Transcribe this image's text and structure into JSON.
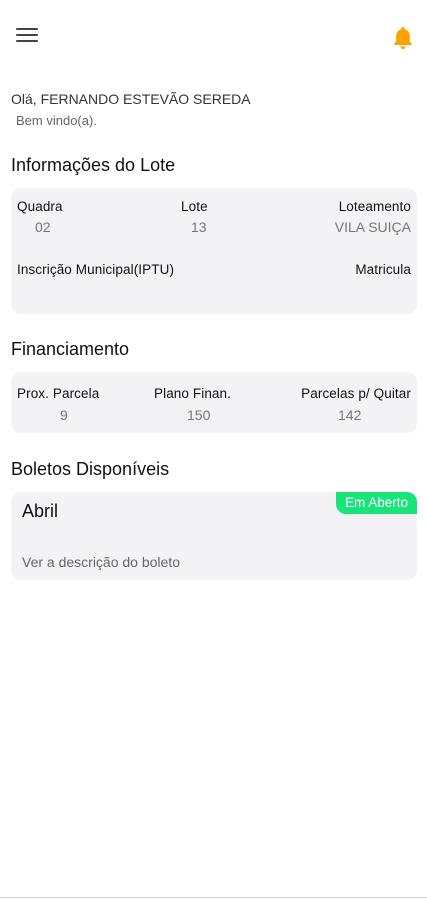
{
  "header": {
    "menu_icon": "hamburger-menu-icon",
    "notification_icon": "bell-icon",
    "notification_color": "#FFA200"
  },
  "greeting": {
    "text": "Olá, FERNANDO ESTEVÃO SEREDA",
    "welcome": "Bem vindo(a)."
  },
  "lote_section": {
    "title": "Informações do Lote",
    "quadra_label": "Quadra",
    "quadra_value": "02",
    "lote_label": "Lote",
    "lote_value": "13",
    "loteamento_label": "Loteamento",
    "loteamento_value": "VILA SUIÇA",
    "inscricao_label": "Inscrição Municipal(IPTU)",
    "matricula_label": "Matricula"
  },
  "financiamento_section": {
    "title": "Financiamento",
    "prox_parcela_label": "Prox. Parcela",
    "prox_parcela_value": "9",
    "plano_label": "Plano Finan.",
    "plano_value": "150",
    "parcelas_label": "Parcelas p/ Quitar",
    "parcelas_value": "142"
  },
  "boletos_section": {
    "title": "Boletos Disponíveis",
    "items": [
      {
        "month": "Abril",
        "status": "Em Aberto",
        "status_color": "#19E47A",
        "description_link": "Ver a descrição do boleto"
      }
    ]
  }
}
